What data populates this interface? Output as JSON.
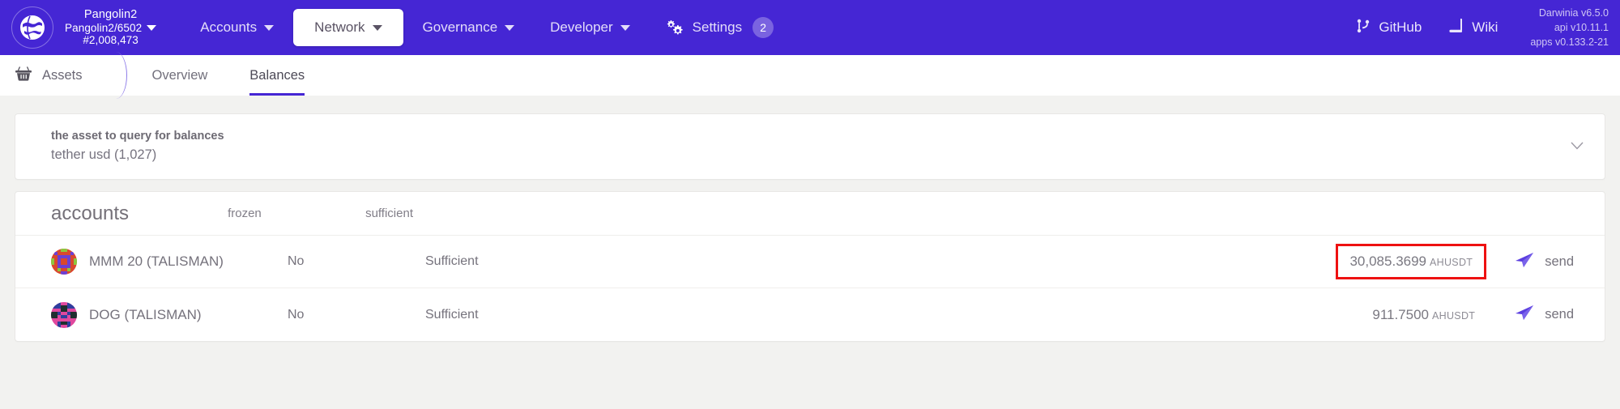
{
  "topbar": {
    "logo_icon": "globe-icon",
    "chain": {
      "name": "Pangolin2",
      "endpoint": "Pangolin2/6502",
      "block": "#2,008,473",
      "caret_icon": "chevron-down-icon"
    },
    "nav": [
      {
        "label": "Accounts",
        "icon": "",
        "caret_icon": "chevron-down-icon",
        "active": false,
        "badge": ""
      },
      {
        "label": "Network",
        "icon": "",
        "caret_icon": "chevron-down-icon",
        "active": true,
        "badge": ""
      },
      {
        "label": "Governance",
        "icon": "",
        "caret_icon": "chevron-down-icon",
        "active": false,
        "badge": ""
      },
      {
        "label": "Developer",
        "icon": "",
        "caret_icon": "chevron-down-icon",
        "active": false,
        "badge": ""
      },
      {
        "label": "Settings",
        "icon": "gear-icon",
        "caret_icon": "",
        "active": false,
        "badge": "2"
      }
    ],
    "links": [
      {
        "label": "GitHub",
        "icon": "git-branch-icon"
      },
      {
        "label": "Wiki",
        "icon": "book-icon"
      }
    ],
    "versions": {
      "line1": "Darwinia v6.5.0",
      "line2": "api v10.11.1",
      "line3": "apps v0.133.2-21"
    },
    "accent_color": "#4526d4"
  },
  "tabbar": {
    "section_label": "Assets",
    "section_icon": "basket-icon",
    "tabs": [
      {
        "label": "Overview",
        "active": false
      },
      {
        "label": "Balances",
        "active": true
      }
    ],
    "active_underline_color": "#4526d4"
  },
  "selector": {
    "label": "the asset to query for balances",
    "value": "tether usd (1,027)",
    "caret_icon": "chevron-down-icon"
  },
  "table": {
    "headers": {
      "accounts": "accounts",
      "frozen": "frozen",
      "sufficient": "sufficient"
    },
    "rows": [
      {
        "avatar": "identicon-avatar",
        "account": "MMM 20 (TALISMAN)",
        "frozen": "No",
        "sufficient": "Sufficient",
        "amount": "30,085.3699",
        "unit": "AHUSDT",
        "highlighted": true,
        "send_label": "send",
        "send_icon": "paper-plane-icon"
      },
      {
        "avatar": "identicon-avatar",
        "account": "DOG (TALISMAN)",
        "frozen": "No",
        "sufficient": "Sufficient",
        "amount": "911.7500",
        "unit": "AHUSDT",
        "highlighted": false,
        "send_label": "send",
        "send_icon": "paper-plane-icon"
      }
    ]
  },
  "annotation": {
    "highlight_color": "#ee1111"
  }
}
